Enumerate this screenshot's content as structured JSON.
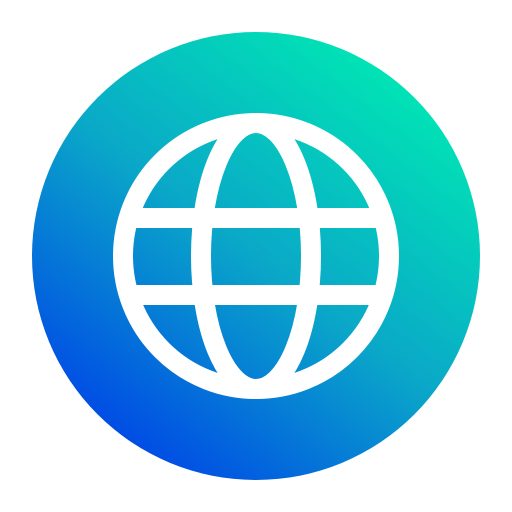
{
  "icon": {
    "name": "globe-icon",
    "gradient": {
      "start": "#0048e6",
      "mid": "#0aa8c8",
      "end": "#00e6b4"
    },
    "stroke_color": "#ffffff"
  }
}
